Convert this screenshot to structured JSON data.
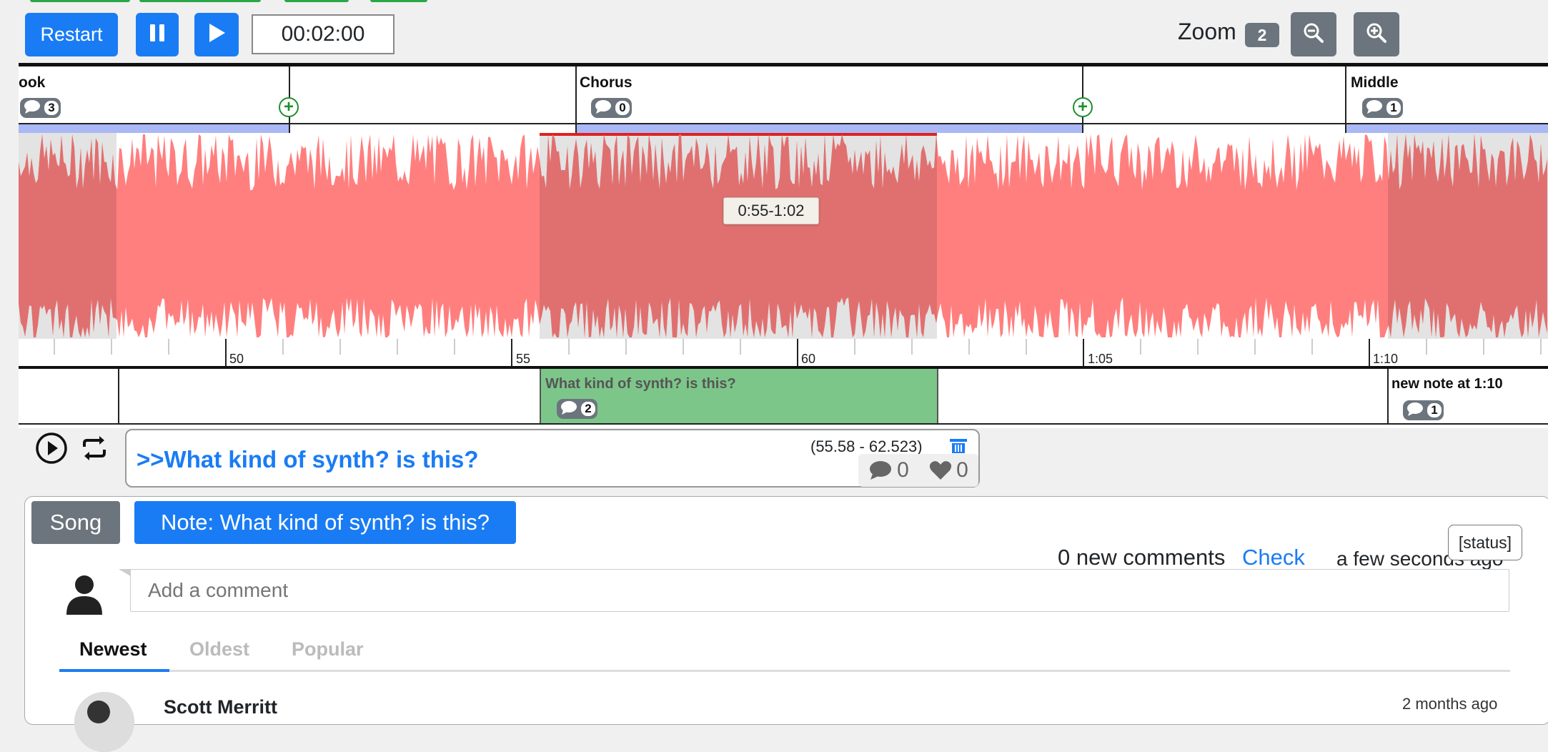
{
  "toolbar": {
    "restart_label": "Restart",
    "time_value": "00:02:00",
    "zoom_label": "Zoom",
    "zoom_level": "2"
  },
  "sections": [
    {
      "label": "ook",
      "comments": "3"
    },
    {
      "label": "Chorus",
      "comments": "0"
    },
    {
      "label": "Middle",
      "comments": "1"
    }
  ],
  "waveform": {
    "color": "#ff7f7f",
    "selected_color": "#e07070",
    "selection_tooltip": "0:55-1:02",
    "ticks": [
      "50",
      "55",
      "60",
      "1:05",
      "1:10"
    ]
  },
  "notes": [
    {
      "label": "What kind of synth? is this?",
      "comments": "2",
      "color": "#7dc68a"
    },
    {
      "label": "new note at 1:10",
      "comments": "1"
    }
  ],
  "note_card": {
    "title": ">>What kind of synth? is this?",
    "range": "(55.58 - 62.523)",
    "comment_count": "0",
    "like_count": "0"
  },
  "comments_panel": {
    "tab_song": "Song",
    "tab_note": "Note: What kind of synth? is this?",
    "status_label": "[status]",
    "new_comments": "0 new comments",
    "check_link": "Check",
    "updated": "a few seconds ago",
    "comment_placeholder": "Add a comment",
    "sort_tabs": [
      "Newest",
      "Oldest",
      "Popular"
    ],
    "first_comment": {
      "author": "Scott Merritt",
      "time": "2 months ago"
    }
  }
}
